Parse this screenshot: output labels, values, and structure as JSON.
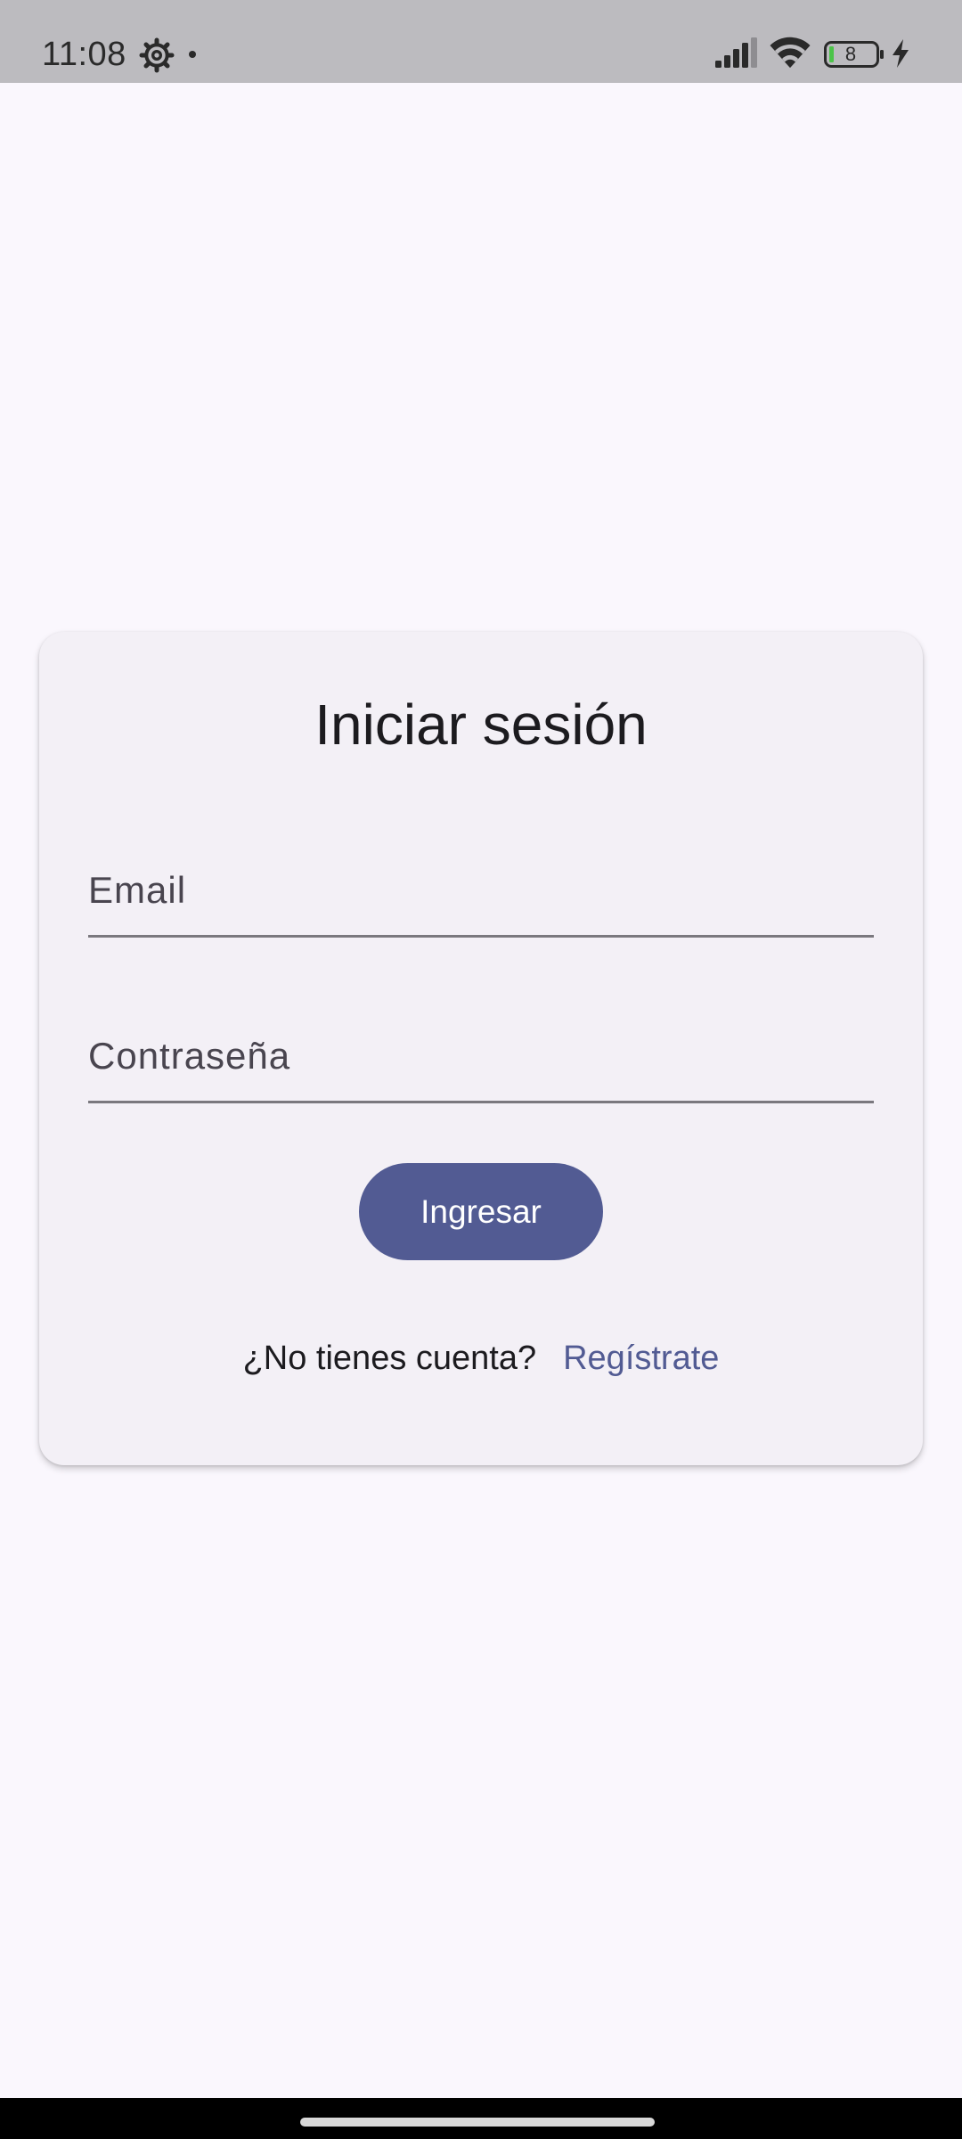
{
  "status_bar": {
    "time": "11:08",
    "battery_level": "8",
    "icons": [
      "gear-icon",
      "notification-dot-icon",
      "signal-icon",
      "wifi-icon",
      "battery-icon",
      "charging-bolt-icon"
    ]
  },
  "login_card": {
    "title": "Iniciar sesión",
    "email": {
      "value": "",
      "placeholder": "Email"
    },
    "password": {
      "value": "",
      "placeholder": "Contraseña"
    },
    "submit_label": "Ingresar",
    "register_prompt": "¿No tienes cuenta?",
    "register_link": "Regístrate"
  },
  "colors": {
    "background": "#faf7fd",
    "card": "#f3f0f6",
    "primary": "#525b93",
    "status_bar": "#bcbbbf"
  }
}
